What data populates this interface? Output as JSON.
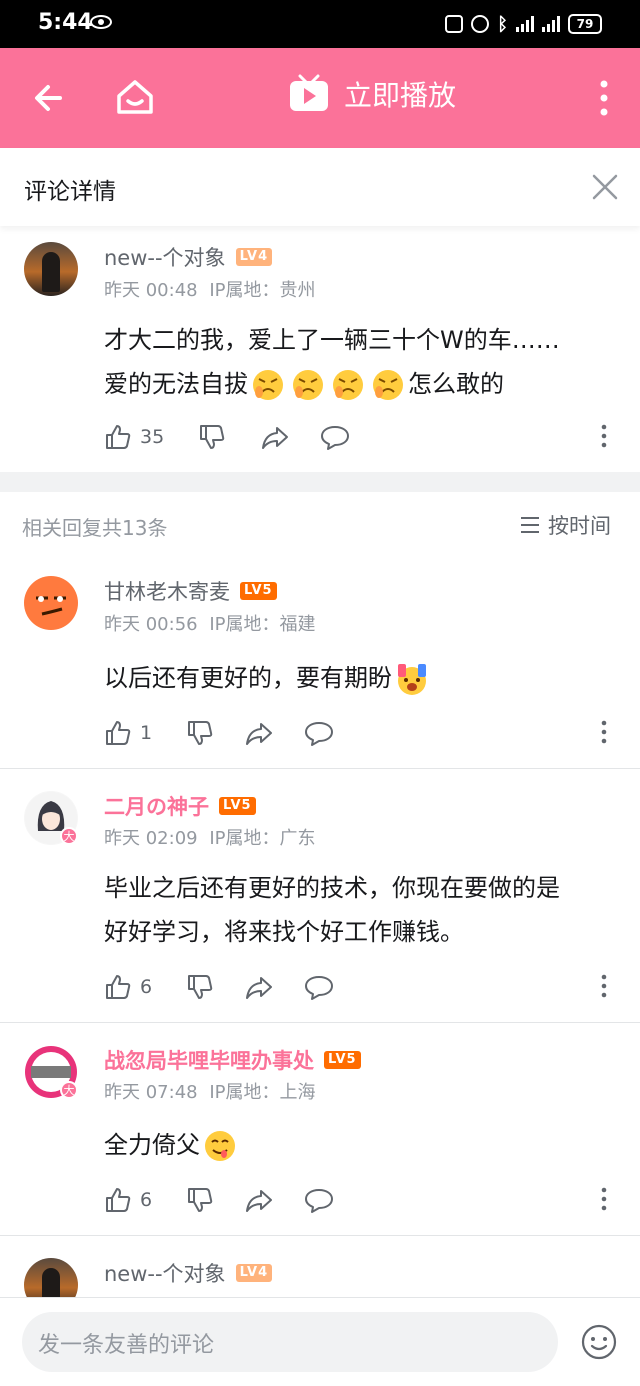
{
  "status_bar": {
    "time": "5:44",
    "battery": "79"
  },
  "app_bar": {
    "play_label": "立即播放"
  },
  "detail_header": {
    "title": "评论详情"
  },
  "main_comment": {
    "username": "new--个对象",
    "level": "LV4",
    "time": "昨天 00:48",
    "ip": "IP属地：贵州",
    "text_line1": "才大二的我，爱上了一辆三十个W的车……",
    "text_line2_prefix": "爱的无法自拔",
    "text_line2_suffix": "怎么敢的",
    "likes": "35"
  },
  "replies_header": {
    "count": "相关回复共13条",
    "sort": "按时间"
  },
  "replies": [
    {
      "username": "甘林老木寄麦",
      "level": "LV5",
      "time": "昨天 00:56",
      "ip": "IP属地：福建",
      "text": "以后还有更好的，要有期盼",
      "likes": "1"
    },
    {
      "username": "二月の神子",
      "level": "LV5",
      "time": "昨天 02:09",
      "ip": "IP属地：广东",
      "text_line1": "毕业之后还有更好的技术，你现在要做的是",
      "text_line2": "好好学习，将来找个好工作赚钱。",
      "likes": "6"
    },
    {
      "username": "战忽局毕哩毕哩办事处",
      "level": "LV5",
      "time": "昨天 07:48",
      "ip": "IP属地：上海",
      "text": "全力倚父",
      "likes": "6"
    },
    {
      "username": "new--个对象",
      "level": "LV4"
    }
  ],
  "bottom_bar": {
    "placeholder": "发一条友善的评论"
  },
  "colors": {
    "brand_pink": "#fb7299",
    "lv4": "#ffb37c",
    "lv5": "#ff6c00"
  }
}
